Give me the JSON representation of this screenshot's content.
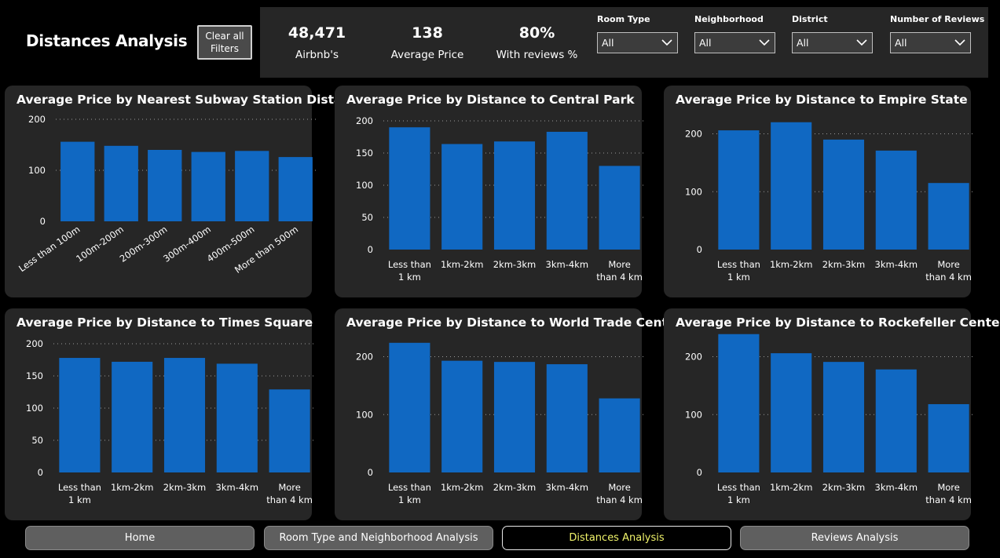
{
  "header": {
    "title": "Distances Analysis",
    "clear_label": "Clear all\nFilters"
  },
  "kpis": [
    {
      "value": "48,471",
      "label": "Airbnb's"
    },
    {
      "value": "138",
      "label": "Average Price"
    },
    {
      "value": "80%",
      "label": "With reviews %"
    }
  ],
  "filters": [
    {
      "label": "Room Type",
      "value": "All"
    },
    {
      "label": "Neighborhood",
      "value": "All"
    },
    {
      "label": "District",
      "value": "All"
    },
    {
      "label": "Number of Reviews",
      "value": "All"
    }
  ],
  "nav": [
    {
      "label": "Home",
      "active": false
    },
    {
      "label": "Room Type and Neighborhood Analysis",
      "active": false
    },
    {
      "label": "Distances Analysis",
      "active": true
    },
    {
      "label": "Reviews Analysis",
      "active": false
    }
  ],
  "colors": {
    "bar": "#1068c2",
    "background": "#000000",
    "card": "#262626",
    "active_nav_text": "#f0f36a"
  },
  "chart_data": [
    {
      "type": "bar",
      "title": "Average Price by Nearest Subway Station Distance",
      "categories": [
        "Less than 100m",
        "100m-200m",
        "200m-300m",
        "300m-400m",
        "400m-500m",
        "More than 500m"
      ],
      "values": [
        156,
        148,
        140,
        136,
        138,
        126
      ],
      "ylim": [
        0,
        200
      ],
      "yticks": [
        0,
        100,
        200
      ],
      "xlabel_rotated": true,
      "grid": true
    },
    {
      "type": "bar",
      "title": "Average Price by Distance to Central Park",
      "categories": [
        "Less than 1 km",
        "1km-2km",
        "2km-3km",
        "3km-4km",
        "More than 4 km"
      ],
      "values": [
        190,
        164,
        168,
        183,
        130
      ],
      "ylim": [
        0,
        200
      ],
      "yticks": [
        0,
        50,
        100,
        150,
        200
      ],
      "grid": true
    },
    {
      "type": "bar",
      "title": "Average Price by Distance to Empire State",
      "categories": [
        "Less than 1 km",
        "1km-2km",
        "2km-3km",
        "3km-4km",
        "More than 4 km"
      ],
      "values": [
        206,
        220,
        190,
        171,
        115
      ],
      "ylim": [
        0,
        240
      ],
      "yticks": [
        0,
        100,
        200
      ],
      "grid": true
    },
    {
      "type": "bar",
      "title": "Average Price by Distance to Times Square",
      "categories": [
        "Less than 1 km",
        "1km-2km",
        "2km-3km",
        "3km-4km",
        "More than 4 km"
      ],
      "values": [
        178,
        172,
        178,
        169,
        129
      ],
      "ylim": [
        0,
        200
      ],
      "yticks": [
        0,
        50,
        100,
        150,
        200
      ],
      "grid": true
    },
    {
      "type": "bar",
      "title": "Average Price by Distance to World Trade Center",
      "categories": [
        "Less than 1 km",
        "1km-2km",
        "2km-3km",
        "3km-4km",
        "More than 4 km"
      ],
      "values": [
        224,
        193,
        191,
        187,
        128
      ],
      "ylim": [
        0,
        240
      ],
      "yticks": [
        0,
        100,
        200
      ],
      "grid": true
    },
    {
      "type": "bar",
      "title": "Average Price by Distance to Rockefeller Center",
      "categories": [
        "Less than 1 km",
        "1km-2km",
        "2km-3km",
        "3km-4km",
        "More than 4 km"
      ],
      "values": [
        239,
        206,
        191,
        178,
        118
      ],
      "ylim": [
        0,
        240
      ],
      "yticks": [
        0,
        100,
        200
      ],
      "grid": true
    }
  ]
}
